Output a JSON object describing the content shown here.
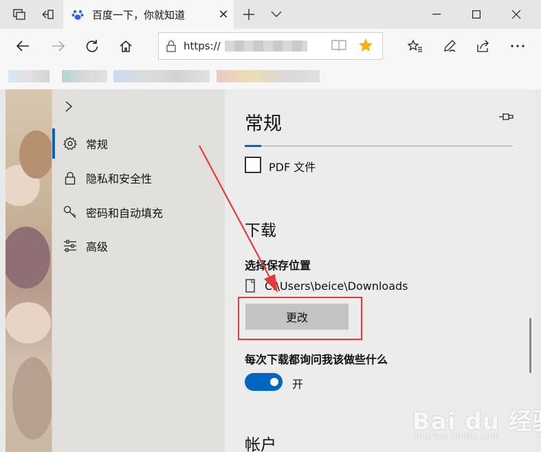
{
  "browser": {
    "tab_title": "百度一下，你就知道",
    "address_prefix": "https://"
  },
  "menu": {
    "items": [
      {
        "label": "常规",
        "icon": "gear-icon",
        "active": true
      },
      {
        "label": "隐私和安全性",
        "icon": "lock-icon",
        "active": false
      },
      {
        "label": "密码和自动填充",
        "icon": "key-icon",
        "active": false
      },
      {
        "label": "高级",
        "icon": "sliders-icon",
        "active": false
      }
    ]
  },
  "panel": {
    "title": "常规",
    "pdf_label": "PDF 文件",
    "downloads": {
      "title": "下载",
      "choose_location": "选择保存位置",
      "path": "C:\\Users\\beice\\Downloads",
      "change_button": "更改",
      "ask_label": "每次下载都询问我该做些什么",
      "ask_toggle_state": "开"
    },
    "next_section": "帐户"
  },
  "watermark": {
    "text": "Bai du 经验",
    "sub": "jingyan.baidu.com"
  },
  "colors": {
    "accent": "#0067c0",
    "highlight": "#e23a3a",
    "star": "#f3b20d"
  }
}
